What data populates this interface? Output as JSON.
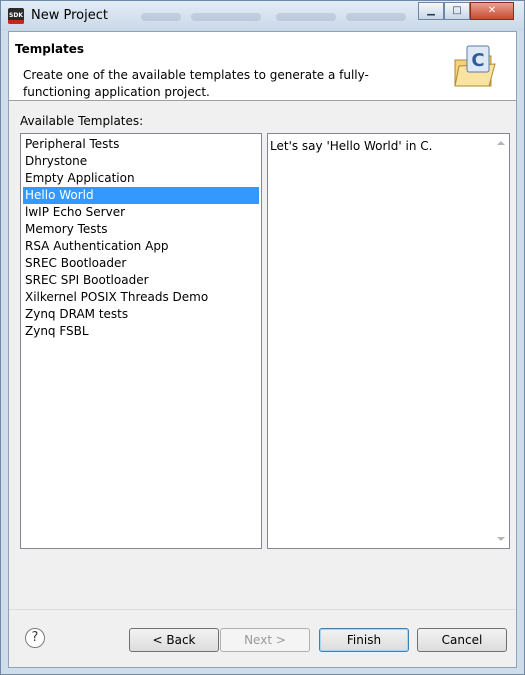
{
  "window": {
    "title": "New Project",
    "app_icon_text": "SDK"
  },
  "banner": {
    "title": "Templates",
    "description": "Create one of the available templates to generate a fully-functioning application project.",
    "icon": "c-folder-icon"
  },
  "templates": {
    "label": "Available Templates:",
    "items": [
      "Peripheral Tests",
      "Dhrystone",
      "Empty Application",
      "Hello World",
      "lwIP Echo Server",
      "Memory Tests",
      "RSA Authentication App",
      "SREC Bootloader",
      "SREC SPI Bootloader",
      "Xilkernel POSIX Threads Demo",
      "Zynq DRAM tests",
      "Zynq FSBL"
    ],
    "selected_index": 3
  },
  "description_panel": {
    "text": "Let's say 'Hello World' in C."
  },
  "buttons": {
    "help_glyph": "?",
    "back": "< Back",
    "next": "Next >",
    "finish": "Finish",
    "cancel": "Cancel"
  },
  "colors": {
    "selection": "#3399ff",
    "window_frame": "#cfdcea",
    "dialog_bg": "#f0f0f0"
  }
}
